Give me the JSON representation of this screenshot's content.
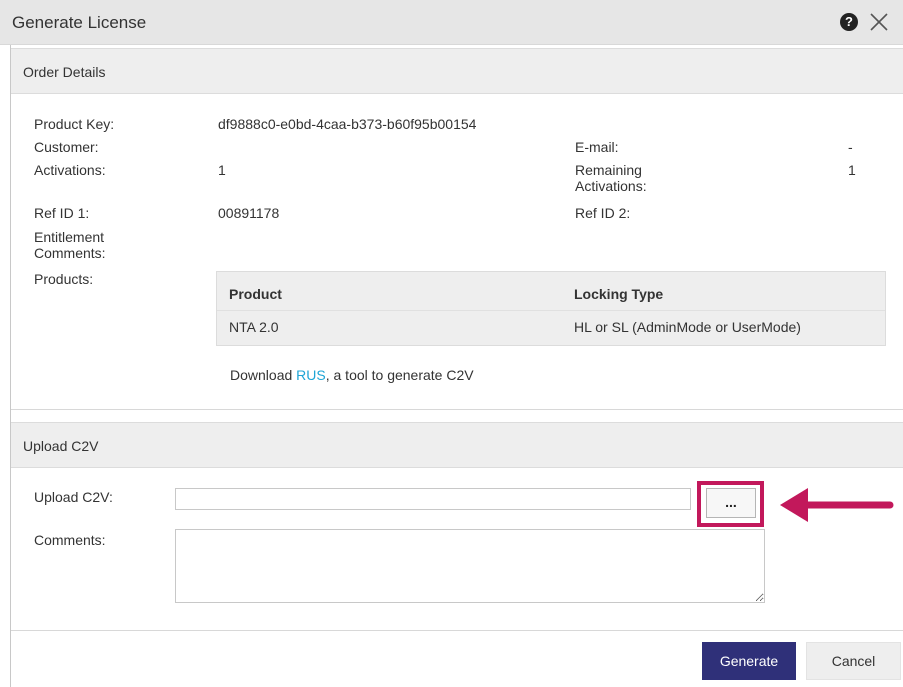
{
  "dialog": {
    "title": "Generate License"
  },
  "icons": {
    "help": "question-circle-icon",
    "close": "close-x-icon"
  },
  "order_details": {
    "header": "Order Details",
    "product_key": {
      "label": "Product Key:",
      "value": "df9888c0-e0bd-4caa-b373-b60f95b00154"
    },
    "customer": {
      "label": "Customer:",
      "value": ""
    },
    "email": {
      "label": "E-mail:",
      "value": "-"
    },
    "activations": {
      "label": "Activations:",
      "value": "1"
    },
    "remaining_activations": {
      "label_line1": "Remaining",
      "label_line2": "Activations:",
      "value": "1"
    },
    "ref_id_1": {
      "label": "Ref ID 1:",
      "value": "00891178"
    },
    "ref_id_2": {
      "label": "Ref ID 2:",
      "value": ""
    },
    "entitlement_comments": {
      "label_line1": "Entitlement",
      "label_line2": "Comments:",
      "value": ""
    },
    "products": {
      "label": "Products:",
      "columns": [
        "Product",
        "Locking Type"
      ],
      "rows": [
        [
          "NTA 2.0",
          "HL or SL (AdminMode or UserMode)"
        ]
      ]
    },
    "download": {
      "prefix": "Download ",
      "link": "RUS",
      "suffix": ", a tool to generate C2V"
    }
  },
  "upload_c2v": {
    "header": "Upload C2V",
    "upload_label": "Upload C2V:",
    "upload_value": "",
    "browse_label": "...",
    "comments_label": "Comments:",
    "comments_value": ""
  },
  "footer": {
    "generate": "Generate",
    "cancel": "Cancel"
  },
  "colors": {
    "accent": "#2f3079",
    "highlight": "#c2185b",
    "link": "#1ea5d6"
  }
}
